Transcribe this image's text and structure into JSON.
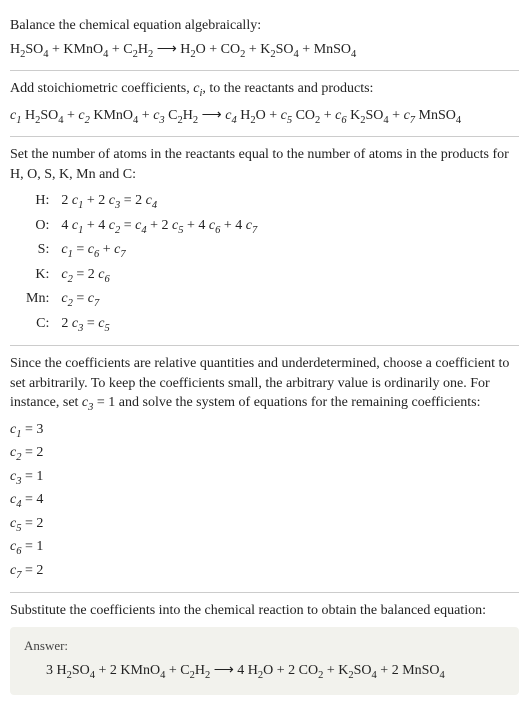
{
  "intro": {
    "line1": "Balance the chemical equation algebraically:",
    "eq_terms": [
      "H",
      "2",
      "SO",
      "4",
      " + KMnO",
      "4",
      " + C",
      "2",
      "H",
      "2",
      "  ⟶  H",
      "2",
      "O + CO",
      "2",
      " + K",
      "2",
      "SO",
      "4",
      " + MnSO",
      "4"
    ]
  },
  "addcoeff": {
    "text_a": "Add stoichiometric coefficients, ",
    "ci": "c",
    "ci_sub": "i",
    "text_b": ", to the reactants and products:",
    "terms": [
      {
        "c": "c",
        "i": "1",
        "f": [
          "H",
          "2",
          "SO",
          "4"
        ]
      },
      {
        "pre": " + ",
        "c": "c",
        "i": "2",
        "f": [
          "KMnO",
          "4"
        ]
      },
      {
        "pre": " + ",
        "c": "c",
        "i": "3",
        "f": [
          "C",
          "2",
          "H",
          "2"
        ]
      },
      {
        "pre": "  ⟶  ",
        "c": "c",
        "i": "4",
        "f": [
          "H",
          "2",
          "O"
        ]
      },
      {
        "pre": " + ",
        "c": "c",
        "i": "5",
        "f": [
          "CO",
          "2"
        ]
      },
      {
        "pre": " + ",
        "c": "c",
        "i": "6",
        "f": [
          "K",
          "2",
          "SO",
          "4"
        ]
      },
      {
        "pre": " + ",
        "c": "c",
        "i": "7",
        "f": [
          "MnSO",
          "4"
        ]
      }
    ]
  },
  "atomset": {
    "intro": "Set the number of atoms in the reactants equal to the number of atoms in the products for H, O, S, K, Mn and C:",
    "rows": [
      {
        "el": "H:",
        "eq": [
          "2 ",
          "c",
          "1",
          " + 2 ",
          "c",
          "3",
          " = 2 ",
          "c",
          "4"
        ]
      },
      {
        "el": "O:",
        "eq": [
          "4 ",
          "c",
          "1",
          " + 4 ",
          "c",
          "2",
          " = ",
          "c",
          "4",
          " + 2 ",
          "c",
          "5",
          " + 4 ",
          "c",
          "6",
          " + 4 ",
          "c",
          "7"
        ]
      },
      {
        "el": "S:",
        "eq": [
          "c",
          "1",
          " = ",
          "c",
          "6",
          " + ",
          "c",
          "7"
        ]
      },
      {
        "el": "K:",
        "eq": [
          "c",
          "2",
          " = 2 ",
          "c",
          "6"
        ]
      },
      {
        "el": "Mn:",
        "eq": [
          "c",
          "2",
          " = ",
          "c",
          "7"
        ]
      },
      {
        "el": "C:",
        "eq": [
          "2 ",
          "c",
          "3",
          " = ",
          "c",
          "5"
        ]
      }
    ]
  },
  "solve": {
    "intro_a": "Since the coefficients are relative quantities and underdetermined, choose a coefficient to set arbitrarily. To keep the coefficients small, the arbitrary value is ordinarily one. For instance, set ",
    "c3": "c",
    "c3_sub": "3",
    "intro_b": " = 1 and solve the system of equations for the remaining coefficients:",
    "coeffs": [
      {
        "c": "c",
        "i": "1",
        "eq": " = 3"
      },
      {
        "c": "c",
        "i": "2",
        "eq": " = 2"
      },
      {
        "c": "c",
        "i": "3",
        "eq": " = 1"
      },
      {
        "c": "c",
        "i": "4",
        "eq": " = 4"
      },
      {
        "c": "c",
        "i": "5",
        "eq": " = 2"
      },
      {
        "c": "c",
        "i": "6",
        "eq": " = 1"
      },
      {
        "c": "c",
        "i": "7",
        "eq": " = 2"
      }
    ]
  },
  "final": {
    "intro": "Substitute the coefficients into the chemical reaction to obtain the balanced equation:",
    "answer_label": "Answer:",
    "eq": [
      "3 H",
      "2",
      "SO",
      "4",
      " + 2 KMnO",
      "4",
      " + C",
      "2",
      "H",
      "2",
      "  ⟶  4 H",
      "2",
      "O + 2 CO",
      "2",
      " + K",
      "2",
      "SO",
      "4",
      " + 2 MnSO",
      "4"
    ]
  }
}
